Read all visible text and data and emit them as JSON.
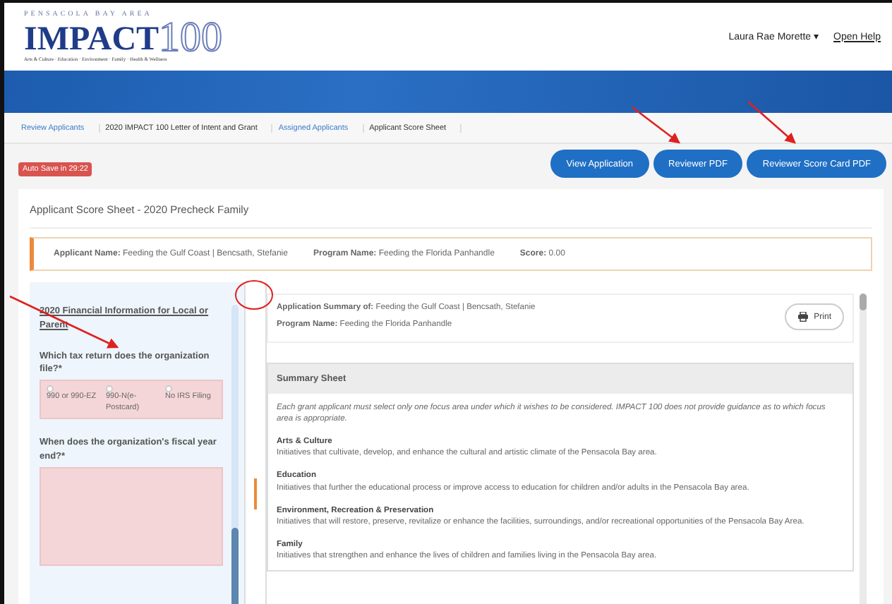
{
  "logo": {
    "region": "PENSACOLA BAY AREA",
    "word": "IMPACT",
    "number": "100",
    "tagline": "Arts & Culture · Education · Environment · Family · Health & Wellness"
  },
  "user_menu": {
    "name": "Laura Rae Morette",
    "caret": "▾",
    "help": "Open Help"
  },
  "breadcrumbs": [
    {
      "label": "Review Applicants",
      "link": true
    },
    {
      "label": "2020 IMPACT 100 Letter of Intent and Grant",
      "link": false
    },
    {
      "label": "Assigned Applicants",
      "link": true
    },
    {
      "label": "Applicant Score Sheet",
      "link": false
    }
  ],
  "autosave": "Auto Save in 29:22",
  "actions": [
    "View Application",
    "Reviewer PDF",
    "Reviewer Score Card PDF"
  ],
  "page_title": "Applicant Score Sheet - 2020 Precheck Family",
  "info_bar": [
    {
      "label": "Applicant Name:",
      "value": "Feeding the Gulf Coast | Bencsath, Stefanie"
    },
    {
      "label": "Program Name:",
      "value": "Feeding the Florida Panhandle"
    },
    {
      "label": "Score:",
      "value": "0.00"
    }
  ],
  "left_panel": {
    "section_title": "2020 Financial Information for Local or Parent",
    "questions": [
      {
        "kind": "radio",
        "label": "Which tax return does the organization file?*",
        "options": [
          {
            "label": "990 or 990-EZ",
            "selected": false
          },
          {
            "label": "990-N(e-Postcard)",
            "selected": false
          },
          {
            "label": "No IRS Filing",
            "selected": false
          }
        ]
      },
      {
        "kind": "textarea",
        "label": "When does the organization's fiscal year end?*"
      }
    ]
  },
  "summary": {
    "applicant_label": "Application Summary of:",
    "applicant": "Feeding the Gulf Coast | Bencsath, Stefanie",
    "program_label": "Program Name:",
    "program": "Feeding the Florida Panhandle",
    "print": "Print"
  },
  "summary_sheet": {
    "title": "Summary Sheet",
    "intro": "Each grant applicant must select only one focus area under which it wishes to be considered. IMPACT 100 does not provide guidance as to which focus area is appropriate.",
    "areas": [
      {
        "name": "Arts & Culture",
        "text": "Initiatives that cultivate, develop, and enhance the cultural and artistic climate of the Pensacola Bay area."
      },
      {
        "name": "Education",
        "text": "Initiatives that further the educational process or improve access to education for children and/or adults in the Pensacola Bay area."
      },
      {
        "name": "Environment, Recreation & Preservation",
        "text": "Initiatives that will restore, preserve, revitalize or enhance the facilities, surroundings, and/or recreational opportunities of the Pensacola Bay Area."
      },
      {
        "name": "Family",
        "text": "Initiatives that strengthen and enhance the lives of children and families living in the Pensacola Bay area."
      }
    ]
  }
}
